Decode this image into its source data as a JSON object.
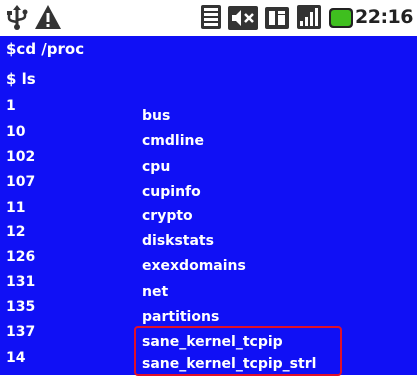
{
  "status_bar": {
    "time": "22:16",
    "icons": [
      "usb-icon",
      "warning-icon",
      "signal-strength-icon",
      "sound-muted-icon",
      "sd-card-icon",
      "network-signal-icon",
      "battery-icon"
    ]
  },
  "terminal": {
    "commands": [
      "$cd /proc",
      "$ ls"
    ],
    "left_column": [
      "1",
      "10",
      "102",
      "107",
      "11",
      "12",
      "126",
      "131",
      "135",
      "137",
      "14"
    ],
    "right_column": [
      "bus",
      "cmdline",
      "cpu",
      "cupinfo",
      "crypto",
      "diskstats",
      "exexdomains",
      "net",
      "partitions",
      "sane_kernel_tcpip",
      "sane_kernel_tcpip_strl"
    ],
    "highlighted_entries": [
      "sane_kernel_tcpip",
      "sane_kernel_tcpip_strl"
    ]
  },
  "colors": {
    "terminal_bg": "#1010f5",
    "highlight_border": "#e0102a",
    "battery": "#3fbf1f"
  }
}
